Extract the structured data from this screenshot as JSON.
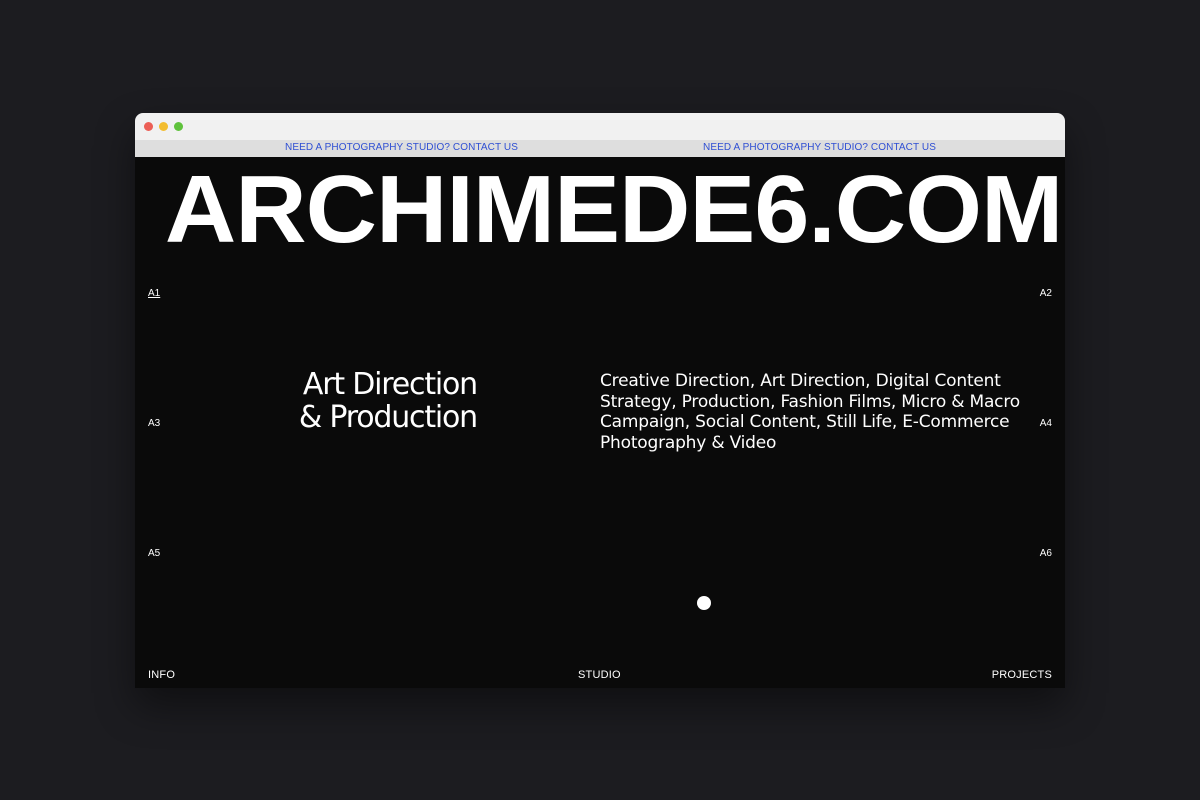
{
  "banner": {
    "left_text": "NEED A PHOTOGRAPHY STUDIO? CONTACT US",
    "right_text": "NEED A PHOTOGRAPHY STUDIO? CONTACT US",
    "color": "#2f4fd3"
  },
  "logo": {
    "text": "ARCHIMEDE6.COM"
  },
  "markers": {
    "a1": "A1",
    "a2": "A2",
    "a3": "A3",
    "a4": "A4",
    "a5": "A5",
    "a6": "A6"
  },
  "headline": {
    "line1": "Art Direction",
    "line2": "& Production"
  },
  "services": {
    "lines": [
      "Creative Direction, Art Direction, Digital Content",
      "Strategy, Production, Fashion Films, Micro & Macro",
      "Campaign, Social Content, Still Life, E-Commerce",
      "Photography & Video"
    ]
  },
  "nav": {
    "info": "INFO",
    "studio": "STUDIO",
    "projects": "PROJECTS"
  },
  "colors": {
    "background": "#0a0a0a",
    "outer": "#1c1c20",
    "text": "#ffffff"
  }
}
